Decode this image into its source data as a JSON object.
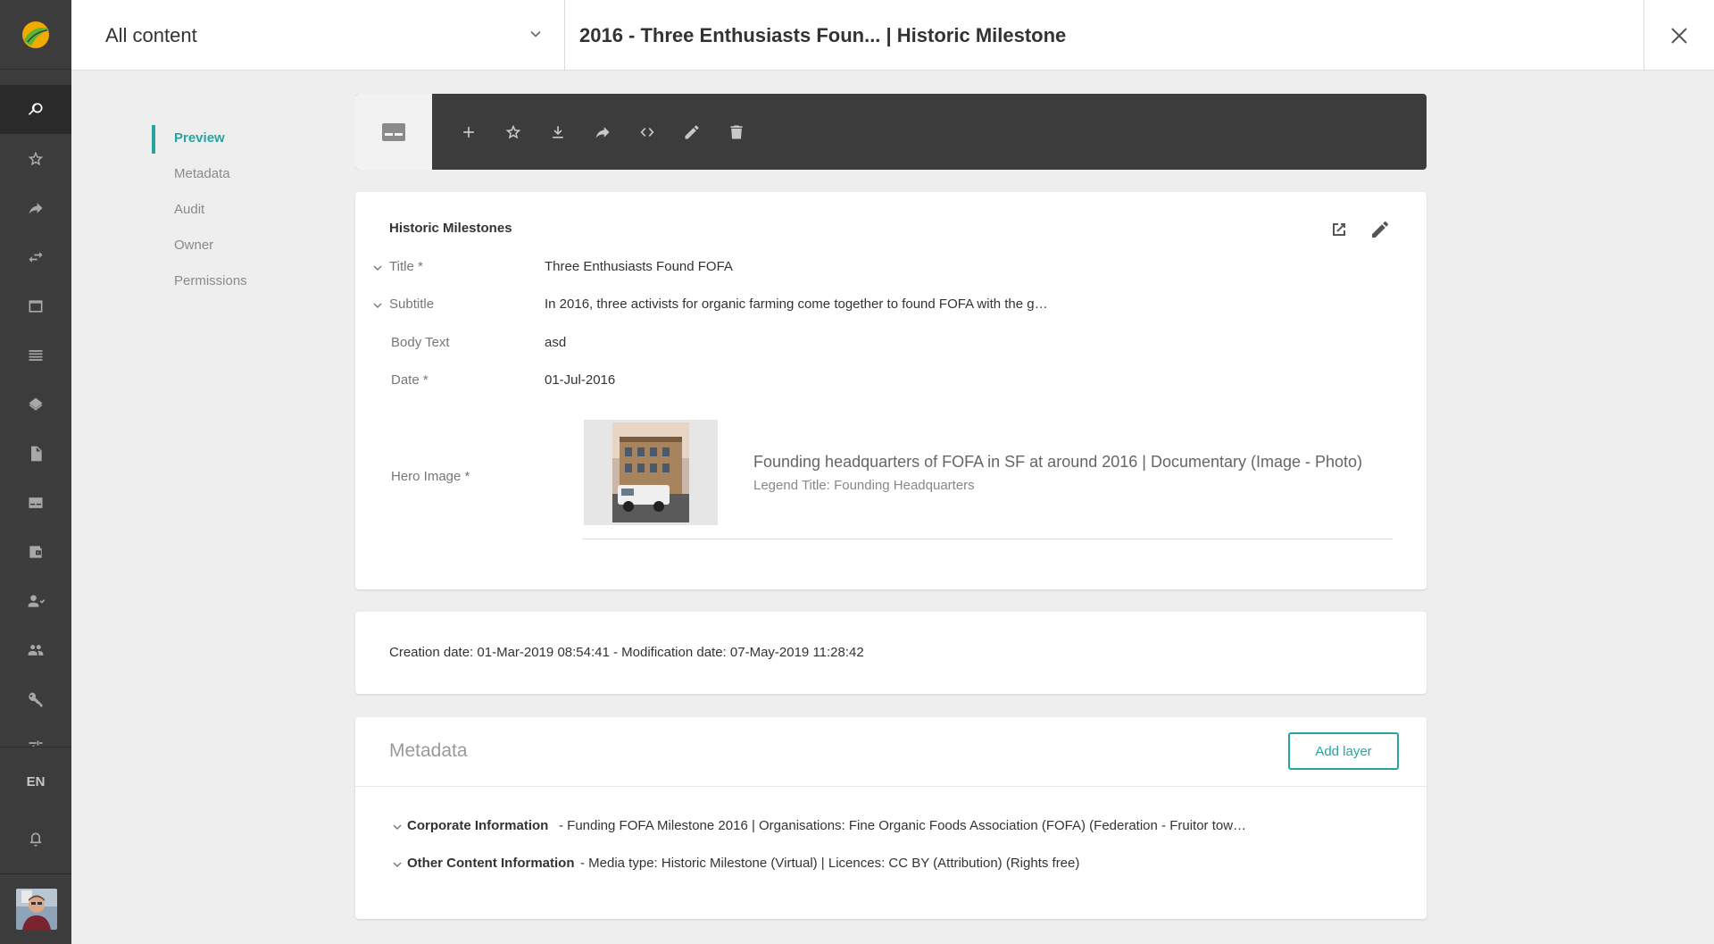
{
  "header": {
    "filter_label": "All content",
    "title": "2016 - Three Enthusiasts Foun... | Historic Milestone"
  },
  "rail": {
    "language": "EN",
    "items": [
      "search-icon",
      "star-icon",
      "share-icon",
      "transfer-icon",
      "window-icon",
      "list-icon",
      "layers-icon",
      "document-icon",
      "card-icon",
      "wallet-icon",
      "user-check-icon",
      "users-icon",
      "key-icon",
      "sliders-icon",
      "bell-icon"
    ]
  },
  "subnav": {
    "items": [
      {
        "label": "Preview",
        "active": true
      },
      {
        "label": "Metadata",
        "active": false
      },
      {
        "label": "Audit",
        "active": false
      },
      {
        "label": "Owner",
        "active": false
      },
      {
        "label": "Permissions",
        "active": false
      }
    ]
  },
  "toolbar": {
    "actions": [
      "add-icon",
      "star-icon",
      "download-icon",
      "share-icon",
      "embed-code-icon",
      "edit-icon",
      "delete-icon"
    ]
  },
  "content": {
    "layer_title": "Historic Milestones",
    "fields": [
      {
        "label": "Title *",
        "value": "Three Enthusiasts Found FOFA",
        "expandable": true
      },
      {
        "label": "Subtitle",
        "value": "In 2016, three activists for organic farming come together to found FOFA with the g…",
        "expandable": true
      },
      {
        "label": "Body Text",
        "value": "asd",
        "expandable": false
      },
      {
        "label": "Date *",
        "value": "01-Jul-2016",
        "expandable": false
      }
    ],
    "hero": {
      "label": "Hero Image *",
      "caption": "Founding headquarters of FOFA in SF at around 2016 | Documentary (Image - Photo)",
      "legend": "Legend Title: Founding Headquarters"
    }
  },
  "dates": {
    "text": "Creation date: 01-Mar-2019 08:54:41 - Modification date: 07-May-2019 11:28:42"
  },
  "metadata": {
    "title": "Metadata",
    "add_layer_label": "Add layer",
    "rows": [
      {
        "key": "Corporate Information",
        "value": "-  Funding FOFA Milestone 2016 | Organisations: Fine Organic Foods Association (FOFA) (Federation - Fruitor tow…"
      },
      {
        "key": "Other Content Information",
        "value": "-  Media type: Historic Milestone (Virtual) | Licences: CC BY (Attribution) (Rights free)"
      }
    ]
  },
  "colors": {
    "accent": "#2aa3a0",
    "rail": "#3c3c3c",
    "toolbar": "#3c3c3c"
  }
}
